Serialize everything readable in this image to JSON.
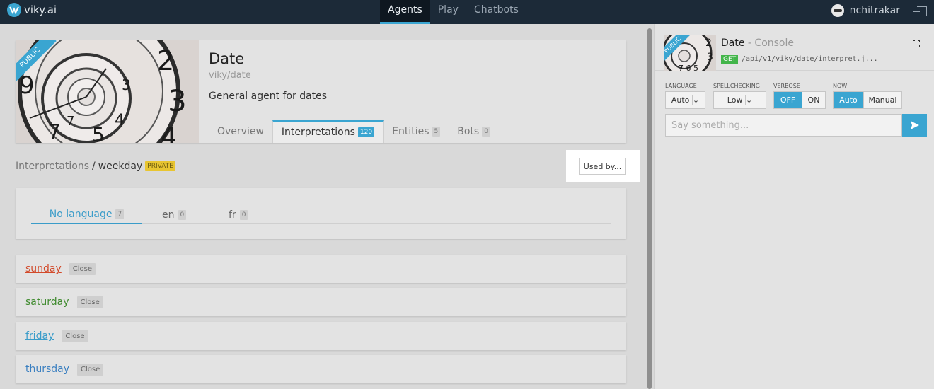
{
  "topbar": {
    "logo": "viky.ai",
    "nav": [
      {
        "label": "Agents",
        "active": true
      },
      {
        "label": "Play",
        "active": false
      },
      {
        "label": "Chatbots",
        "active": false
      }
    ],
    "user": "nchitrakar"
  },
  "agent": {
    "ribbon": "PUBLIC",
    "title": "Date",
    "slug": "viky/date",
    "description": "General agent for dates",
    "tabs": [
      {
        "label": "Overview",
        "count": null
      },
      {
        "label": "Interpretations",
        "count": "120"
      },
      {
        "label": "Entities",
        "count": "5"
      },
      {
        "label": "Bots",
        "count": "0"
      }
    ]
  },
  "breadcrumb": {
    "link": "Interpretations",
    "separator": "/",
    "current": "weekday",
    "badge": "PRIVATE"
  },
  "used_by": "Used by...",
  "languages": [
    {
      "label": "No language",
      "count": "7"
    },
    {
      "label": "en",
      "count": "0"
    },
    {
      "label": "fr",
      "count": "0"
    }
  ],
  "interpretations": [
    {
      "name": "sunday",
      "badge": "Close",
      "color": "#d24a2a"
    },
    {
      "name": "saturday",
      "badge": "Close",
      "color": "#3f8a2e"
    },
    {
      "name": "friday",
      "badge": "Close",
      "color": "#3a9cc9"
    },
    {
      "name": "thursday",
      "badge": "Close",
      "color": "#3a7fc0"
    }
  ],
  "console": {
    "ribbon": "PUBLIC",
    "title": "Date",
    "subtitle": "- Console",
    "method": "GET",
    "endpoint": "/api/v1/viky/date/interpret.j...",
    "language": {
      "label": "LANGUAGE",
      "value": "Auto"
    },
    "spellchecking": {
      "label": "SPELLCHECKING",
      "value": "Low"
    },
    "verbose": {
      "label": "VERBOSE",
      "off": "OFF",
      "on": "ON"
    },
    "now": {
      "label": "NOW",
      "auto": "Auto",
      "manual": "Manual"
    },
    "input_placeholder": "Say something..."
  },
  "colors": {
    "accent": "#3aa5d1",
    "topbar": "#1c2a38",
    "private": "#e8c531",
    "get": "#42b54a"
  }
}
